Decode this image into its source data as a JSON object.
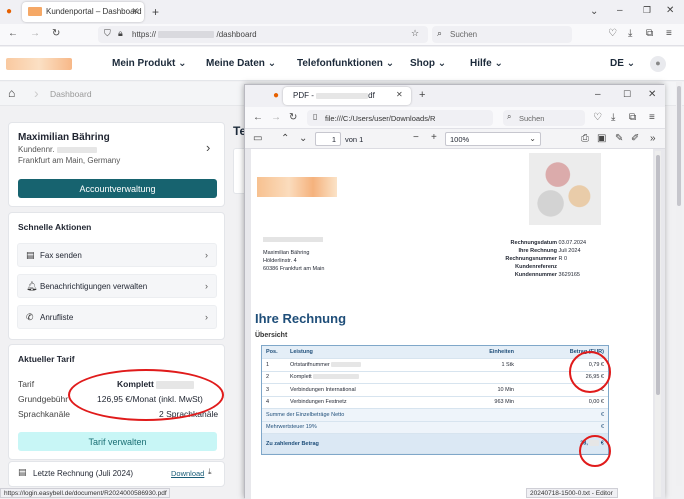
{
  "browser": {
    "tab_title": "Kundenportal – Dashboard",
    "url": "https://",
    "url_path": "/dashboard",
    "search_placeholder": "Suchen"
  },
  "site": {
    "nav": [
      "Mein Produkt",
      "Meine Daten",
      "Telefonfunktionen",
      "Shop",
      "Hilfe"
    ],
    "language": "DE",
    "breadcrumb": "Dashboard"
  },
  "customer": {
    "name": "Maximilian Bähring",
    "number_label": "Kundennr.",
    "city": "Frankfurt am Main, Germany",
    "account_button": "Accountverwaltung"
  },
  "quick_actions": {
    "title": "Schnelle Aktionen",
    "items": [
      "Fax senden",
      "Benachrichtigungen verwalten",
      "Anrufliste"
    ]
  },
  "tariff": {
    "title": "Aktueller Tarif",
    "rows": [
      {
        "label": "Tarif",
        "value": "Komplett"
      },
      {
        "label": "Grundgebühr",
        "value": "126,95 €/Monat (inkl. MwSt)"
      },
      {
        "label": "Sprachkanäle",
        "value": "2 Sprachkanäle"
      }
    ],
    "button": "Tarif verwalten"
  },
  "last_invoice": {
    "label": "Letzte Rechnung (Juli 2024)",
    "download": "Download"
  },
  "partial_heading": "Te",
  "status_url": "https://login.easybell.de/document/R2024000586930.pdf",
  "status_right": "20240718-1500-0.txt - Editor",
  "pdf_window": {
    "tab_title": "PDF -",
    "tab_suffix": "df",
    "url": "file:///C:/Users/user/Downloads/R",
    "search_placeholder": "Suchen",
    "page_current": "1",
    "page_total": "von 1",
    "zoom": "100%"
  },
  "invoice": {
    "address": [
      "Maximilian Bähring",
      "Hölderlinstr. 4",
      "60386 Frankfurt am Main"
    ],
    "meta": [
      {
        "label": "Rechnungsdatum",
        "value": "03.07.2024"
      },
      {
        "label": "Ihre Rechnung",
        "value": "Juli 2024"
      },
      {
        "label": "Rechnungsnummer",
        "value": "R                0"
      },
      {
        "label": "Kundenreferenz",
        "value": ""
      },
      {
        "label": "Kundennummer",
        "value": "3629165"
      }
    ],
    "title": "Ihre Rechnung",
    "subtitle": "Übersicht",
    "headers": [
      "Pos.",
      "Leistung",
      "Einheiten",
      "Betrag (EUR)"
    ],
    "rows": [
      {
        "pos": "1",
        "desc": "Ortstarifnummer",
        "units": "1 Stk",
        "amount": "0,79 €"
      },
      {
        "pos": "2",
        "desc": "Komplett",
        "units": "",
        "amount": "26,95 €"
      },
      {
        "pos": "3",
        "desc": "Verbindungen International",
        "units": "10 Min",
        "amount": "€"
      },
      {
        "pos": "4",
        "desc": "Verbindungen Festnetz",
        "units": "963 Min",
        "amount": "0,00 €"
      }
    ],
    "sum_label": "Summe der Einzelbeträge Netto",
    "vat_label": "Mehrwertsteuer 19%",
    "sum_value": "€",
    "vat_value": "€",
    "total_label": "Zu zahlender Betrag",
    "total_value": "28,"
  },
  "colors": {
    "teal": "#17636f",
    "light_teal": "#c8f6f6",
    "annotation_red": "#e01b1b",
    "invoice_blue": "#1f4e79"
  }
}
